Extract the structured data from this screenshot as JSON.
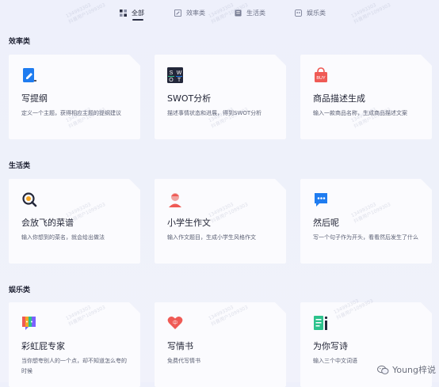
{
  "tabs": [
    {
      "label": "全部",
      "icon": "grid-icon",
      "active": true
    },
    {
      "label": "效率类",
      "icon": "edit-icon",
      "active": false
    },
    {
      "label": "生活类",
      "icon": "book-icon",
      "active": false
    },
    {
      "label": "娱乐类",
      "icon": "game-icon",
      "active": false
    }
  ],
  "sections": [
    {
      "title": "效率类",
      "cards": [
        {
          "title": "写提纲",
          "desc": "定义一个主题，获得相应主题的提纲建议",
          "icon": "document-edit-icon"
        },
        {
          "title": "SWOT分析",
          "desc": "描述事情状态和进展，得到SWOT分析",
          "icon": "swot-icon"
        },
        {
          "title": "商品描述生成",
          "desc": "输入一款商品名称，生成商品描述文案",
          "icon": "shopping-bag-icon",
          "icon_text": "BUY"
        }
      ]
    },
    {
      "title": "生活类",
      "cards": [
        {
          "title": "会放飞的菜谱",
          "desc": "输入你想到的菜名，就会给出做法",
          "icon": "magnifier-icon"
        },
        {
          "title": "小学生作文",
          "desc": "输入作文题目，生成小学生风格作文",
          "icon": "student-avatar-icon"
        },
        {
          "title": "然后呢",
          "desc": "写一个句子作为开头，看看然后发生了什么",
          "icon": "chat-bubble-icon"
        }
      ]
    },
    {
      "title": "娱乐类",
      "cards": [
        {
          "title": "彩虹屁专家",
          "desc": "当你想夸别人的一个点，却不知道怎么夸的时候",
          "icon": "rainbow-bubble-icon"
        },
        {
          "title": "写情书",
          "desc": "免费代写情书",
          "icon": "heart-icon",
          "icon_text": "中"
        },
        {
          "title": "为你写诗",
          "desc": "输入三个中文词语",
          "icon": "poem-icon"
        }
      ]
    }
  ],
  "watermark": {
    "line1": "134993303",
    "line2": "抖音用户1099303"
  },
  "brand": {
    "label": "Young梓说",
    "icon": "wechat-icon"
  },
  "colors": {
    "accent": "#2b2f44",
    "blue": "#1f7cf0",
    "red": "#ef5a55",
    "green": "#2cc28c",
    "dark": "#23273a"
  }
}
